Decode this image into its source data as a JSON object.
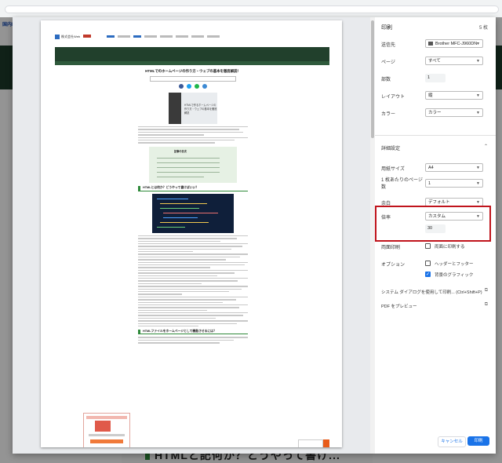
{
  "background": {
    "tab_label": "国内IT"
  },
  "preview": {
    "site_name": "株式会社Web",
    "article_title": "HTMLでのホームページの作り方・ウェブの基本を徹底解説！",
    "image_caption": "HTMLで作るホームページの作り方・ウェブの基本を徹底解説",
    "toc_title": "記事の目次",
    "h2_first": "HTMLとは何か？どうやって書けばいい？",
    "h2_second": "HTMLファイルをホームページとして機能させるには？",
    "bottom_heading": "HTMLと記何か？とうやって書け..."
  },
  "panel": {
    "title": "印刷",
    "sheet_count": "5 枚",
    "destination": {
      "label": "送信先",
      "value": "Brother MFC-J960DN"
    },
    "pages": {
      "label": "ページ",
      "value": "すべて"
    },
    "copies": {
      "label": "部数",
      "value": "1"
    },
    "layout": {
      "label": "レイアウト",
      "value": "縦"
    },
    "color": {
      "label": "カラー",
      "value": "カラー"
    },
    "advanced": {
      "label": "詳細設定"
    },
    "paper_size": {
      "label": "用紙サイズ",
      "value": "A4"
    },
    "pages_per_sheet": {
      "label": "1 枚あたりのページ数",
      "value": "1"
    },
    "margins": {
      "label": "余白",
      "value": "デフォルト"
    },
    "scale": {
      "label": "倍率",
      "value": "カスタム",
      "custom_value": "30"
    },
    "duplex": {
      "label": "両面印刷",
      "option": "両面に印刷する",
      "checked": false
    },
    "options": {
      "label": "オプション",
      "headers_footers": {
        "label": "ヘッダーとフッター",
        "checked": false
      },
      "background_graphics": {
        "label": "背景のグラフィック",
        "checked": true
      }
    },
    "system_dialog": "システム ダイアログを使用して印刷... (Ctrl+Shift+P)",
    "pdf_preview": "PDF をプレビュー",
    "cancel_button": "キャンセル",
    "print_button": "印刷"
  },
  "colors": {
    "accent": "#1a73e8",
    "highlight_border": "#c0141c",
    "header_dark_green": "#1d3a2a"
  }
}
